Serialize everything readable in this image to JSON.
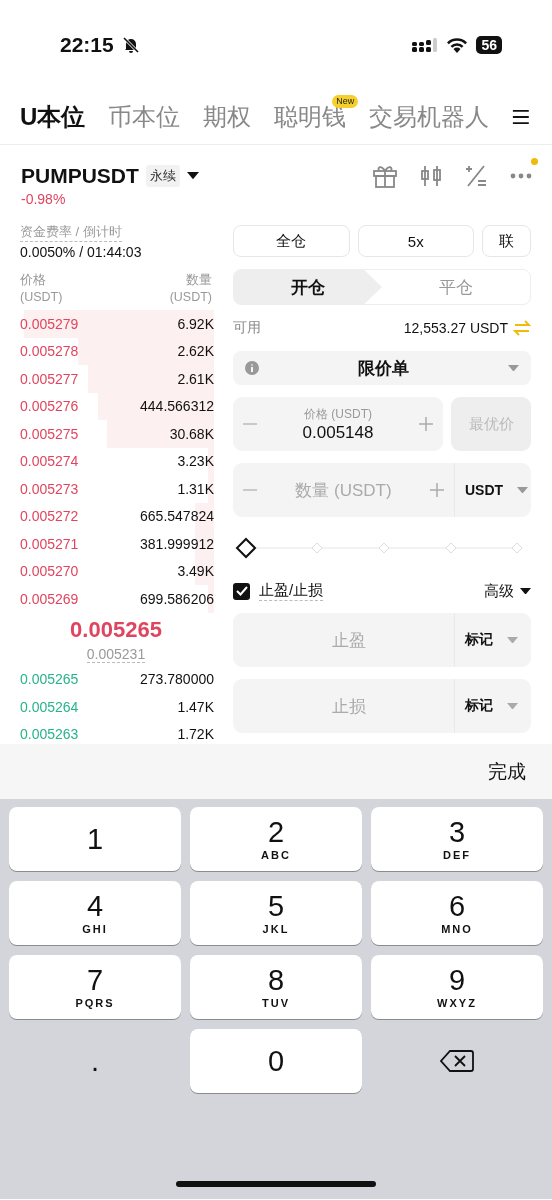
{
  "status_bar": {
    "time": "22:15",
    "battery": "56"
  },
  "tabs": [
    {
      "label": "U本位",
      "selected": true
    },
    {
      "label": "币本位",
      "selected": false
    },
    {
      "label": "期权",
      "selected": false
    },
    {
      "label": "聪明钱",
      "selected": false,
      "badge": "New"
    },
    {
      "label": "交易机器人",
      "selected": false
    }
  ],
  "symbol": {
    "name": "PUMPUSDT",
    "type": "永续",
    "change": "-0.98%"
  },
  "funding": {
    "label": "资金费率 / 倒计时",
    "value": "0.0050% / 01:44:03"
  },
  "order_book": {
    "columns": [
      {
        "label": "价格",
        "unit": "(USDT)"
      },
      {
        "label": "数量",
        "unit": "(USDT)"
      }
    ],
    "asks": [
      {
        "price": "0.005279",
        "amount": "6.92K"
      },
      {
        "price": "0.005278",
        "amount": "2.62K"
      },
      {
        "price": "0.005277",
        "amount": "2.61K"
      },
      {
        "price": "0.005276",
        "amount": "444.566312"
      },
      {
        "price": "0.005275",
        "amount": "30.68K"
      },
      {
        "price": "0.005274",
        "amount": "3.23K"
      },
      {
        "price": "0.005273",
        "amount": "1.31K"
      },
      {
        "price": "0.005272",
        "amount": "665.547824"
      },
      {
        "price": "0.005271",
        "amount": "381.999912"
      },
      {
        "price": "0.005270",
        "amount": "3.49K"
      },
      {
        "price": "0.005269",
        "amount": "699.586206"
      }
    ],
    "last_price": "0.005265",
    "mark_price": "0.005231",
    "bids": [
      {
        "price": "0.005265",
        "amount": "273.780000"
      },
      {
        "price": "0.005264",
        "amount": "1.47K"
      },
      {
        "price": "0.005263",
        "amount": "1.72K"
      }
    ]
  },
  "form": {
    "margin_mode": "全仓",
    "leverage": "5x",
    "link": "联",
    "sides": [
      {
        "label": "开仓",
        "selected": true
      },
      {
        "label": "平仓",
        "selected": false
      }
    ],
    "available_label": "可用",
    "available": "12,553.27 USDT",
    "order_type": "限价单",
    "price": {
      "label": "价格 (USDT)",
      "value": "0.005148"
    },
    "best_price": {
      "label": "最优价",
      "disabled": true
    },
    "quantity": {
      "placeholder": "数量 (USDT)",
      "unit": "USDT"
    },
    "tpsl": {
      "label": "止盈/止损",
      "checked": true
    },
    "advanced": "高级",
    "take_profit": {
      "placeholder": "止盈",
      "trigger": "标记"
    },
    "stop_loss": {
      "placeholder": "止损",
      "trigger": "标记"
    }
  },
  "keyboard": {
    "done": "完成",
    "keys": [
      {
        "kind": "digit",
        "label": "1"
      },
      {
        "kind": "digit",
        "label": "2",
        "letters": "ABC"
      },
      {
        "kind": "digit",
        "label": "3",
        "letters": "DEF"
      },
      {
        "kind": "digit",
        "label": "4",
        "letters": "GHI"
      },
      {
        "kind": "digit",
        "label": "5",
        "letters": "JKL"
      },
      {
        "kind": "digit",
        "label": "6",
        "letters": "MNO"
      },
      {
        "kind": "digit",
        "label": "7",
        "letters": "PQRS"
      },
      {
        "kind": "digit",
        "label": "8",
        "letters": "TUV"
      },
      {
        "kind": "digit",
        "label": "9",
        "letters": "WXYZ"
      },
      {
        "kind": "dot",
        "label": "."
      },
      {
        "kind": "digit",
        "label": "0"
      },
      {
        "kind": "delete"
      }
    ]
  }
}
